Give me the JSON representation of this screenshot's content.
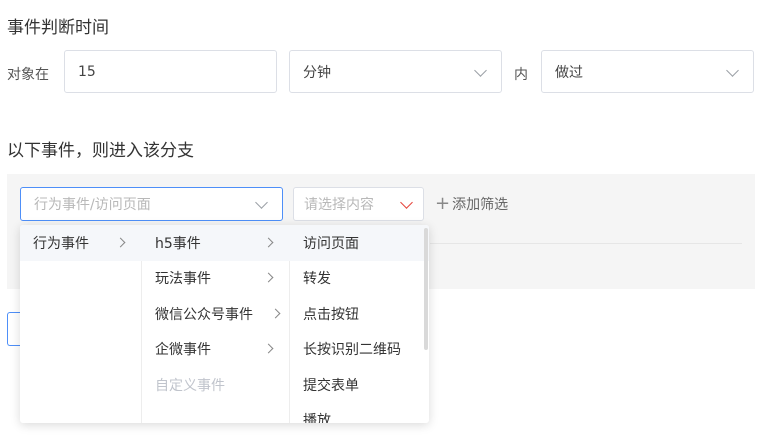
{
  "timing": {
    "title": "事件判断时间",
    "object_label": "对象在",
    "value": "15",
    "unit": "分钟",
    "within_label": "内",
    "action": "做过"
  },
  "branch": {
    "title": "以下事件，则进入该分支",
    "event_placeholder": "行为事件/访问页面",
    "content_placeholder": "请选择内容",
    "add_filter": "添加筛选"
  },
  "cascader": {
    "col1": [
      {
        "label": "行为事件",
        "has_children": true,
        "selected": true
      }
    ],
    "col2": [
      {
        "label": "h5事件",
        "has_children": true,
        "selected": true
      },
      {
        "label": "玩法事件",
        "has_children": true
      },
      {
        "label": "微信公众号事件",
        "has_children": true
      },
      {
        "label": "企微事件",
        "has_children": true
      },
      {
        "label": "自定义事件",
        "disabled": true
      }
    ],
    "col3": [
      {
        "label": "访问页面",
        "selected": true
      },
      {
        "label": "转发"
      },
      {
        "label": "点击按钮"
      },
      {
        "label": "长按识别二维码"
      },
      {
        "label": "提交表单"
      },
      {
        "label": "播放"
      }
    ]
  },
  "colors": {
    "accent": "#4e8ff8",
    "error_chevron": "#e5443b"
  },
  "icons": [
    "chevron-down-icon",
    "chevron-right-icon",
    "plus-icon"
  ]
}
